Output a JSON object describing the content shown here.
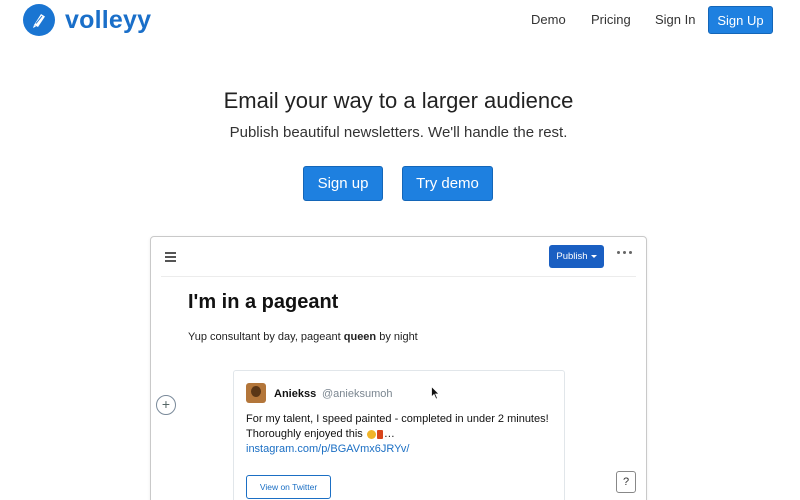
{
  "brand": {
    "name": "volleyy",
    "logo_icon": "pen-nib-icon",
    "color": "#1a6fc9"
  },
  "nav": {
    "links": [
      "Demo",
      "Pricing",
      "Sign In"
    ],
    "signup_label": "Sign Up"
  },
  "hero": {
    "title": "Email your way to a larger audience",
    "subtitle": "Publish beautiful newsletters. We'll handle the rest.",
    "primary_button": "Sign up",
    "secondary_button": "Try demo"
  },
  "editor": {
    "menu_icon": "hamburger-icon",
    "publish_label": "Publish",
    "more_icon": "more-dots-icon",
    "post_title": "I'm in a pageant",
    "post_body_before": "Yup consultant by day, pageant ",
    "post_body_bold": "queen",
    "post_body_after": " by night",
    "add_block_icon": "plus-icon",
    "help_label": "?",
    "tweet": {
      "name": "Aniekss",
      "handle": "@anieksumoh",
      "text_line1": "For my talent, I speed painted - completed in under 2 minutes!",
      "text_line2_start": "Thoroughly enjoyed this",
      "text_line2_end": "…",
      "link": "instagram.com/p/BGAVmx6JRYv/",
      "view_button": "View on Twitter"
    }
  },
  "colors": {
    "accent": "#1e80e0",
    "publish": "#1a5fc2"
  }
}
